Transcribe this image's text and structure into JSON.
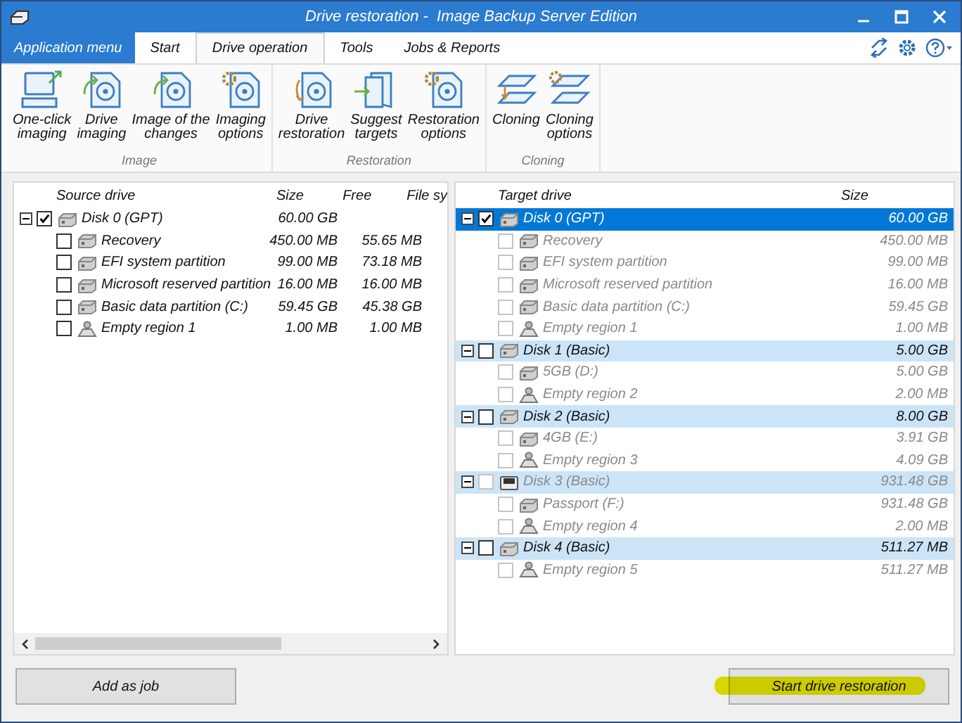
{
  "window": {
    "title": "Drive restoration -  Image Backup Server Edition"
  },
  "app_menu": "Application menu",
  "tabs": [
    {
      "label": "Start",
      "selected": false
    },
    {
      "label": "Drive operation",
      "selected": true
    },
    {
      "label": "Tools",
      "selected": false
    },
    {
      "label": "Jobs & Reports",
      "selected": false
    }
  ],
  "ribbon": [
    {
      "name": "Image",
      "items": [
        {
          "kind": "computer",
          "lines": [
            "One-click",
            "imaging"
          ]
        },
        {
          "kind": "image",
          "lines": [
            "Drive",
            "imaging"
          ]
        },
        {
          "kind": "image",
          "lines": [
            "Image of the",
            "changes"
          ]
        },
        {
          "kind": "options",
          "lines": [
            "Imaging",
            "options"
          ]
        }
      ]
    },
    {
      "name": "Restoration",
      "items": [
        {
          "kind": "restore",
          "lines": [
            "Drive",
            "restoration"
          ]
        },
        {
          "kind": "targets",
          "lines": [
            "Suggest",
            "targets"
          ]
        },
        {
          "kind": "options",
          "lines": [
            "Restoration",
            "options"
          ]
        }
      ]
    },
    {
      "name": "Cloning",
      "items": [
        {
          "kind": "clone",
          "lines": [
            "Cloning"
          ]
        },
        {
          "kind": "clone-options",
          "lines": [
            "Cloning",
            "options"
          ]
        }
      ]
    }
  ],
  "source": {
    "columns": [
      "Source drive",
      "Size",
      "Free",
      "File sy"
    ],
    "rows": [
      {
        "kind": "disk",
        "name": "Disk 0 (GPT)",
        "size": "60.00 GB",
        "checked": true,
        "expanded": true,
        "children": [
          {
            "kind": "partition",
            "name": "Recovery",
            "size": "450.00 MB",
            "free": "55.65 MB",
            "checked": false
          },
          {
            "kind": "partition",
            "name": "EFI system partition",
            "size": "99.00 MB",
            "free": "73.18 MB",
            "checked": false
          },
          {
            "kind": "partition",
            "name": "Microsoft reserved partition",
            "size": "16.00 MB",
            "free": "16.00 MB",
            "checked": false
          },
          {
            "kind": "partition",
            "name": "Basic data partition (C:)",
            "size": "59.45 GB",
            "free": "45.38 GB",
            "checked": false
          },
          {
            "kind": "empty",
            "name": "Empty region 1",
            "size": "1.00 MB",
            "free": "1.00 MB",
            "checked": false
          }
        ]
      }
    ]
  },
  "target": {
    "columns": [
      "Target drive",
      "Size"
    ],
    "rows": [
      {
        "kind": "disk",
        "name": "Disk 0 (GPT)",
        "size": "60.00 GB",
        "checked": true,
        "expanded": true,
        "selected": true,
        "disabled": false,
        "children": [
          {
            "kind": "partition",
            "name": "Recovery",
            "size": "450.00 MB",
            "checked": false,
            "selected": false,
            "disabled": true
          },
          {
            "kind": "partition",
            "name": "EFI system partition",
            "size": "99.00 MB",
            "checked": false,
            "selected": false,
            "disabled": true
          },
          {
            "kind": "partition",
            "name": "Microsoft reserved partition",
            "size": "16.00 MB",
            "checked": false,
            "selected": false,
            "disabled": true
          },
          {
            "kind": "partition",
            "name": "Basic data partition (C:)",
            "size": "59.45 GB",
            "checked": false,
            "selected": false,
            "disabled": true
          },
          {
            "kind": "empty",
            "name": "Empty region 1",
            "size": "1.00 MB",
            "checked": false,
            "selected": false,
            "disabled": true
          }
        ]
      },
      {
        "kind": "disk",
        "name": "Disk 1 (Basic)",
        "size": "5.00 GB",
        "checked": false,
        "expanded": true,
        "selected": false,
        "disabled": false,
        "children": [
          {
            "kind": "partition",
            "name": "5GB (D:)",
            "size": "5.00 GB",
            "checked": false,
            "selected": false,
            "disabled": true
          },
          {
            "kind": "empty",
            "name": "Empty region 2",
            "size": "2.00 MB",
            "checked": false,
            "selected": false,
            "disabled": true
          }
        ]
      },
      {
        "kind": "disk",
        "name": "Disk 2 (Basic)",
        "size": "8.00 GB",
        "checked": false,
        "expanded": true,
        "selected": false,
        "disabled": false,
        "children": [
          {
            "kind": "partition",
            "name": "4GB (E:)",
            "size": "3.91 GB",
            "checked": false,
            "selected": false,
            "disabled": true
          },
          {
            "kind": "empty",
            "name": "Empty region 3",
            "size": "4.09 GB",
            "checked": false,
            "selected": false,
            "disabled": true
          }
        ]
      },
      {
        "kind": "usb",
        "name": "Disk 3 (Basic)",
        "size": "931.48 GB",
        "checked": false,
        "expanded": true,
        "selected": false,
        "disabled": true,
        "children": [
          {
            "kind": "partition",
            "name": "Passport (F:)",
            "size": "931.48 GB",
            "checked": false,
            "selected": false,
            "disabled": true
          },
          {
            "kind": "empty",
            "name": "Empty region 4",
            "size": "2.00 MB",
            "checked": false,
            "selected": false,
            "disabled": true
          }
        ]
      },
      {
        "kind": "disk",
        "name": "Disk 4 (Basic)",
        "size": "511.27 MB",
        "checked": false,
        "expanded": true,
        "selected": false,
        "disabled": false,
        "children": [
          {
            "kind": "empty",
            "name": "Empty region 5",
            "size": "511.27 MB",
            "checked": false,
            "selected": false,
            "disabled": true
          }
        ]
      }
    ]
  },
  "buttons": [
    {
      "label": "Add as job",
      "highlighted": false
    },
    {
      "label": "Start drive restoration",
      "highlighted": true
    }
  ]
}
